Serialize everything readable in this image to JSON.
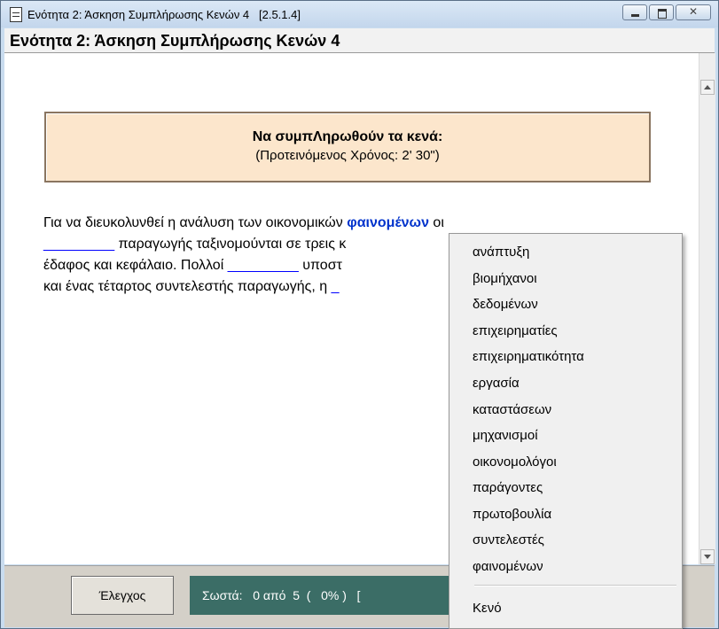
{
  "window": {
    "title": "Ενότητα 2: Άσκηση Συμπλήρωσης Κενών 4   [2.5.1.4]"
  },
  "heading": "Ενότητα 2: Άσκηση Συμπλήρωσης Κενών 4",
  "instructions": {
    "title": "Να συμπΛηρωθούν τα κενά:",
    "subtitle": "(Προτεινόμενος Χρόνος: 2' 30\")"
  },
  "exercise": {
    "line1_a": "Για να διευκολυνθεί η ανάλυση των οικονομικών ",
    "line1_word": "φαινομένων",
    "line1_b": " οι",
    "blank1": "_________",
    "line2_b": " παραγωγής ταξινομούνται σε τρεις κ",
    "line3_a": "έδαφος και κεφάλαιο. Πολλοί ",
    "blank2": "_________",
    "line3_b": " υποστ",
    "line4_a": "και ένας τέταρτος συντελεστής παραγωγής, η ",
    "blank3": "_"
  },
  "footer": {
    "check_label": "Έλεγχος",
    "score_text": "Σωστά:   0 από  5  (   0% )   ["
  },
  "context_menu": {
    "items": [
      "ανάπτυξη",
      "βιομήχανοι",
      "δεδομένων",
      "επιχειρηματίες",
      "επιχειρηματικότητα",
      "εργασία",
      "καταστάσεων",
      "μηχανισμοί",
      "οικονομολόγοι",
      "παράγοντες",
      "πρωτοβουλία",
      "συντελεστές",
      "φαινομένων"
    ],
    "empty_label": "Κενό"
  },
  "icons": {
    "app": "document-icon",
    "minimize": "minimize-icon",
    "maximize": "maximize-icon",
    "close": "close-icon",
    "scroll_up": "scroll-up-arrow-icon",
    "scroll_down": "scroll-down-arrow-icon"
  },
  "colors": {
    "instruction_bg": "#fce6cc",
    "score_bg": "#3b6d66",
    "blank": "#0000ff",
    "keyword": "#0033cc"
  }
}
